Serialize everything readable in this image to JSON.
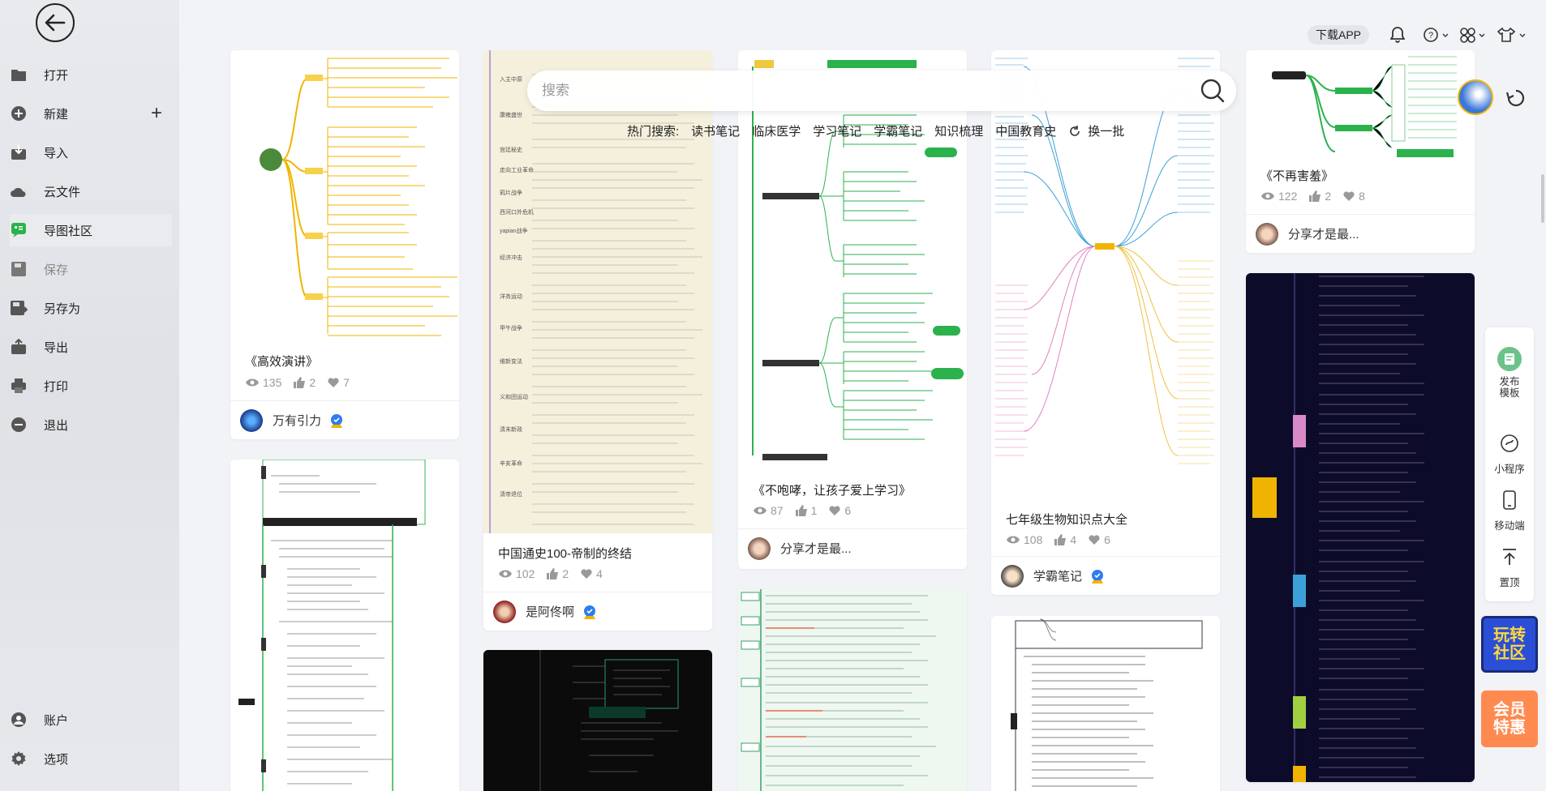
{
  "sidebar": {
    "items": [
      {
        "label": "打开",
        "icon": "folder-icon"
      },
      {
        "label": "新建",
        "icon": "plus-circle-icon"
      },
      {
        "label": "导入",
        "icon": "import-icon"
      },
      {
        "label": "云文件",
        "icon": "cloud-icon"
      },
      {
        "label": "导图社区",
        "icon": "community-icon"
      },
      {
        "label": "保存",
        "icon": "save-icon"
      },
      {
        "label": "另存为",
        "icon": "save-as-icon"
      },
      {
        "label": "导出",
        "icon": "export-icon"
      },
      {
        "label": "打印",
        "icon": "printer-icon"
      },
      {
        "label": "退出",
        "icon": "minus-circle-icon"
      },
      {
        "label": "账户",
        "icon": "user-icon"
      },
      {
        "label": "选项",
        "icon": "gear-icon"
      }
    ]
  },
  "topbar": {
    "download_app": "下载APP"
  },
  "search": {
    "placeholder": "搜索",
    "hot_label": "热门搜索:",
    "hot_terms": [
      "读书笔记",
      "临床医学",
      "学习笔记",
      "学霸笔记",
      "知识梳理",
      "中国教育史"
    ],
    "refresh_label": "换一批"
  },
  "cards": [
    {
      "title": "《高效演讲》",
      "views": "135",
      "likes": "2",
      "favs": "7",
      "author": "万有引力"
    },
    {
      "title": "中国通史100-帝制的终结",
      "views": "102",
      "likes": "2",
      "favs": "4",
      "author": "是阿佟啊"
    },
    {
      "title": "《不咆哮，让孩子爱上学习》",
      "views": "87",
      "likes": "1",
      "favs": "6",
      "author": "分享才是最..."
    },
    {
      "title": "七年级生物知识点大全",
      "views": "108",
      "likes": "4",
      "favs": "6",
      "author": "学霸笔记"
    },
    {
      "title": "《不再害羞》",
      "views": "122",
      "likes": "2",
      "favs": "8",
      "author": "分享才是最..."
    }
  ],
  "float_panel": {
    "publish": "发布模板",
    "miniprogram": "小程序",
    "mobile": "移动端",
    "top": "置顶"
  },
  "promos": {
    "community": "玩转社区",
    "vip": "会员特惠"
  },
  "colors": {
    "sidebar_bg": "#e4e6ea",
    "accent_green": "#2bb24c",
    "page_bg": "#f2f3f7"
  }
}
